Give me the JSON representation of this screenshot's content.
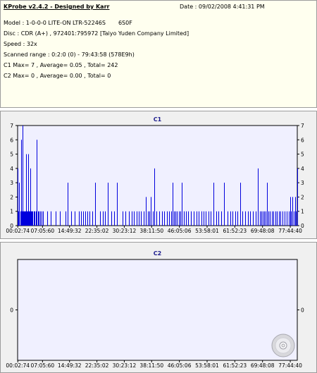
{
  "info": {
    "title": "KProbe v2.4.2 - Designed by Karr",
    "date": "Date : 09/02/2008 4:41:31 PM",
    "model": "Model : 1-0-0-0 LITE-ON LTR-52246S",
    "firmware": "6S0F",
    "disc": "Disc : CDR (A+) , 972401:795972 [Taiyo Yuden Company Limited]",
    "speed": "Speed : 32x",
    "range": "Scanned range : 0:2:0 (0) - 79:43:58 (578E9h)",
    "c1": "C1 Max= 7 , Average= 0.05 , Total= 242",
    "c2": "C2 Max= 0 , Average= 0.00 , Total= 0"
  },
  "colors": {
    "bar": "#0000dd",
    "plot_bg": "#f0f0ff",
    "panel_bg": "#f0f0f0",
    "info_bg": "#ffffef",
    "title": "#1a1a8c"
  },
  "icons": [
    "cd-disc-icon"
  ],
  "chart_data": [
    {
      "type": "bar",
      "title": "C1",
      "ylim": [
        0,
        7
      ],
      "yticks": [
        0,
        1,
        2,
        3,
        4,
        5,
        6,
        7
      ],
      "xlim": [
        0,
        79.7
      ],
      "xtick_labels": [
        "00:02:74",
        "07:05:60",
        "14:49:32",
        "22:35:02",
        "30:23:12",
        "38:11:50",
        "46:05:06",
        "53:58:01",
        "61:52:23",
        "69:48:08",
        "77:44:40"
      ],
      "xtick_minutes": [
        0.05,
        7.1,
        14.8,
        22.6,
        30.4,
        38.2,
        46.1,
        54.0,
        61.9,
        69.8,
        77.7
      ],
      "points": [
        [
          0.1,
          4
        ],
        [
          0.3,
          1
        ],
        [
          0.5,
          3
        ],
        [
          0.8,
          1
        ],
        [
          1.0,
          6
        ],
        [
          1.2,
          1
        ],
        [
          1.5,
          7
        ],
        [
          1.7,
          1
        ],
        [
          1.9,
          1
        ],
        [
          2.1,
          1
        ],
        [
          2.3,
          1
        ],
        [
          2.5,
          5
        ],
        [
          2.7,
          1
        ],
        [
          2.9,
          1
        ],
        [
          3.1,
          5
        ],
        [
          3.3,
          1
        ],
        [
          3.5,
          1
        ],
        [
          3.7,
          4
        ],
        [
          3.9,
          1
        ],
        [
          4.1,
          1
        ],
        [
          4.3,
          1
        ],
        [
          4.6,
          1
        ],
        [
          4.9,
          1
        ],
        [
          5.2,
          1
        ],
        [
          5.5,
          6
        ],
        [
          5.8,
          1
        ],
        [
          6.1,
          1
        ],
        [
          6.5,
          1
        ],
        [
          6.9,
          1
        ],
        [
          7.3,
          1
        ],
        [
          8.5,
          1
        ],
        [
          9.5,
          1
        ],
        [
          10.8,
          1
        ],
        [
          12.1,
          1
        ],
        [
          13.6,
          1
        ],
        [
          14.3,
          3
        ],
        [
          15.2,
          1
        ],
        [
          16.3,
          1
        ],
        [
          17.4,
          1
        ],
        [
          18.1,
          1
        ],
        [
          18.6,
          1
        ],
        [
          19.3,
          1
        ],
        [
          19.9,
          1
        ],
        [
          20.4,
          1
        ],
        [
          21.3,
          1
        ],
        [
          22.0,
          3
        ],
        [
          23.5,
          1
        ],
        [
          24.2,
          1
        ],
        [
          24.9,
          1
        ],
        [
          25.6,
          3
        ],
        [
          26.8,
          1
        ],
        [
          27.6,
          1
        ],
        [
          28.3,
          3
        ],
        [
          30.0,
          1
        ],
        [
          30.8,
          1
        ],
        [
          31.7,
          1
        ],
        [
          32.5,
          1
        ],
        [
          33.2,
          1
        ],
        [
          33.9,
          1
        ],
        [
          34.6,
          1
        ],
        [
          35.2,
          1
        ],
        [
          35.9,
          1
        ],
        [
          36.5,
          2
        ],
        [
          37.1,
          1
        ],
        [
          37.6,
          1
        ],
        [
          38.0,
          2
        ],
        [
          38.5,
          1
        ],
        [
          39.0,
          4
        ],
        [
          39.6,
          1
        ],
        [
          40.4,
          1
        ],
        [
          41.1,
          1
        ],
        [
          41.8,
          1
        ],
        [
          42.5,
          1
        ],
        [
          43.1,
          1
        ],
        [
          43.7,
          1
        ],
        [
          44.1,
          3
        ],
        [
          44.5,
          1
        ],
        [
          45.0,
          1
        ],
        [
          45.4,
          1
        ],
        [
          45.9,
          1
        ],
        [
          46.3,
          1
        ],
        [
          46.8,
          3
        ],
        [
          47.3,
          1
        ],
        [
          47.9,
          1
        ],
        [
          48.6,
          1
        ],
        [
          49.4,
          1
        ],
        [
          50.1,
          1
        ],
        [
          50.9,
          1
        ],
        [
          51.6,
          1
        ],
        [
          52.3,
          1
        ],
        [
          53.0,
          1
        ],
        [
          53.7,
          1
        ],
        [
          54.4,
          1
        ],
        [
          55.1,
          1
        ],
        [
          55.8,
          3
        ],
        [
          56.6,
          1
        ],
        [
          57.3,
          1
        ],
        [
          58.1,
          1
        ],
        [
          58.9,
          3
        ],
        [
          59.8,
          1
        ],
        [
          60.6,
          1
        ],
        [
          61.3,
          1
        ],
        [
          62.0,
          1
        ],
        [
          62.7,
          1
        ],
        [
          63.4,
          3
        ],
        [
          64.1,
          1
        ],
        [
          64.9,
          1
        ],
        [
          65.6,
          1
        ],
        [
          66.3,
          1
        ],
        [
          67.1,
          1
        ],
        [
          67.8,
          1
        ],
        [
          68.5,
          4
        ],
        [
          69.0,
          1
        ],
        [
          69.4,
          1
        ],
        [
          69.8,
          1
        ],
        [
          70.2,
          1
        ],
        [
          70.6,
          1
        ],
        [
          71.1,
          3
        ],
        [
          71.5,
          1
        ],
        [
          71.9,
          1
        ],
        [
          72.4,
          1
        ],
        [
          72.9,
          1
        ],
        [
          73.4,
          1
        ],
        [
          73.9,
          1
        ],
        [
          74.4,
          1
        ],
        [
          74.9,
          1
        ],
        [
          75.4,
          1
        ],
        [
          76.0,
          1
        ],
        [
          76.6,
          1
        ],
        [
          77.2,
          1
        ],
        [
          77.6,
          2
        ],
        [
          77.9,
          1
        ],
        [
          78.3,
          2
        ],
        [
          78.7,
          1
        ],
        [
          79.0,
          2
        ],
        [
          79.3,
          1
        ],
        [
          79.6,
          4
        ]
      ]
    },
    {
      "type": "bar",
      "title": "C2",
      "ylim": [
        -1,
        1
      ],
      "yticks": [
        0
      ],
      "xlim": [
        0,
        79.7
      ],
      "xtick_labels": [
        "00:02:74",
        "07:05:60",
        "14:49:32",
        "22:35:02",
        "30:23:12",
        "38:11:50",
        "46:05:06",
        "53:58:01",
        "61:52:23",
        "69:48:08",
        "77:44:40"
      ],
      "xtick_minutes": [
        0.05,
        7.1,
        14.8,
        22.6,
        30.4,
        38.2,
        46.1,
        54.0,
        61.9,
        69.8,
        77.7
      ],
      "points": []
    }
  ]
}
